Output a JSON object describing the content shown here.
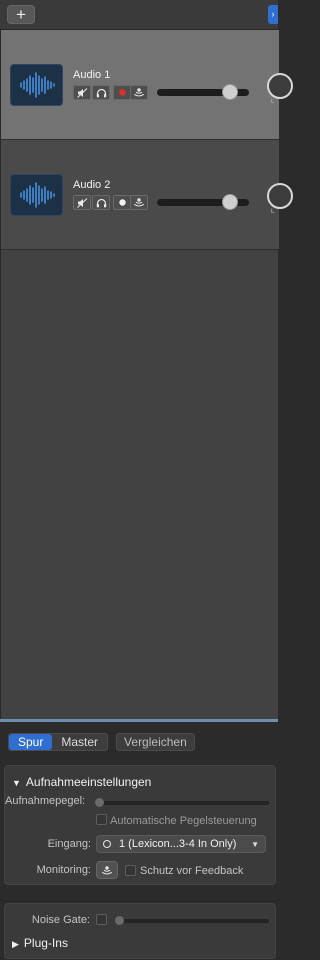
{
  "toolbar": {
    "add_label": "+",
    "expand_label": "›"
  },
  "tracks": [
    {
      "name": "Audio 1",
      "selected": true,
      "record_armed": true,
      "volume": 0.8
    },
    {
      "name": "Audio 2",
      "selected": false,
      "record_armed": false,
      "volume": 0.8
    }
  ],
  "inspector": {
    "tabs": [
      "Spur",
      "Master"
    ],
    "active_tab": "Spur",
    "compare_label": "Vergleichen",
    "recording_settings": {
      "title": "Aufnahmeeinstellungen",
      "level_label": "Aufnahmepegel:",
      "auto_level_label": "Automatische Pegelsteuerung",
      "input_label": "Eingang:",
      "input_value": "1  (Lexicon...3-4 In Only)",
      "monitoring_label": "Monitoring:",
      "feedback_label": "Schutz vor Feedback"
    },
    "noise_gate_label": "Noise Gate:",
    "plugins_label": "Plug-Ins"
  },
  "colors": {
    "accent": "#2f6fd1",
    "record": "#e0302a",
    "waveform": "#4a8fe0",
    "selected_track": "#737373"
  },
  "icons": [
    "add-icon",
    "mute-icon",
    "headphones-icon",
    "record-icon",
    "monitoring-icon",
    "waveform-icon",
    "disclosure-triangle-icon",
    "chevron-down-icon"
  ]
}
